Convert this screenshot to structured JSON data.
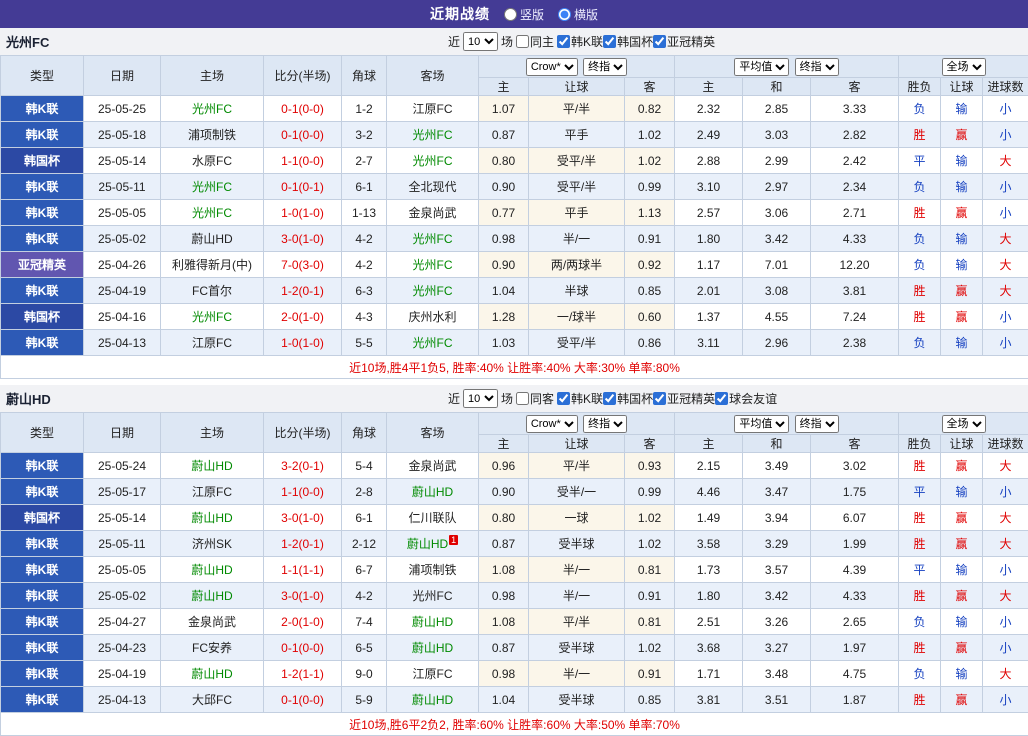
{
  "topbar": {
    "title": "近期战绩",
    "options": [
      {
        "label": "竖版",
        "selected": false
      },
      {
        "label": "横版",
        "selected": true
      }
    ]
  },
  "sections": [
    {
      "team": "光州FC",
      "filter": {
        "near": "近",
        "count": "10",
        "unit": "场",
        "same": "同主",
        "leagues": [
          "韩K联",
          "韩国杯",
          "亚冠精英"
        ]
      },
      "header": {
        "type": "类型",
        "date": "日期",
        "home": "主场",
        "score": "比分(半场)",
        "corner": "角球",
        "away": "客场",
        "odds_source": "Crow*",
        "odds_close": "终指",
        "avg_source": "平均值",
        "avg_close": "终指",
        "scope": "全场",
        "sub_home": "主",
        "sub_handicap": "让球",
        "sub_away": "客",
        "sub_home2": "主",
        "sub_draw": "和",
        "sub_away2": "客",
        "sub_result": "胜负",
        "sub_result_handicap": "让球",
        "sub_goals": "进球数"
      },
      "rows": [
        {
          "type": "韩K联",
          "date": "25-05-25",
          "home": "光州FC",
          "score": "0-1(0-0)",
          "corner": "1-2",
          "away": "江原FC",
          "crow": [
            "1.07",
            "平/半",
            "0.82"
          ],
          "avg": [
            "2.32",
            "2.85",
            "3.33"
          ],
          "res": [
            "负",
            "输",
            "小"
          ]
        },
        {
          "type": "韩K联",
          "date": "25-05-18",
          "home": "浦项制铁",
          "score": "0-1(0-0)",
          "corner": "3-2",
          "away": "光州FC",
          "crow": [
            "0.87",
            "平手",
            "1.02"
          ],
          "avg": [
            "2.49",
            "3.03",
            "2.82"
          ],
          "res": [
            "胜",
            "赢",
            "小"
          ]
        },
        {
          "type": "韩国杯",
          "date": "25-05-14",
          "home": "水原FC",
          "score": "1-1(0-0)",
          "corner": "2-7",
          "away": "光州FC",
          "crow": [
            "0.80",
            "受平/半",
            "1.02"
          ],
          "avg": [
            "2.88",
            "2.99",
            "2.42"
          ],
          "res": [
            "平",
            "输",
            "大"
          ]
        },
        {
          "type": "韩K联",
          "date": "25-05-11",
          "home": "光州FC",
          "score": "0-1(0-1)",
          "corner": "6-1",
          "away": "全北现代",
          "crow": [
            "0.90",
            "受平/半",
            "0.99"
          ],
          "avg": [
            "3.10",
            "2.97",
            "2.34"
          ],
          "res": [
            "负",
            "输",
            "小"
          ]
        },
        {
          "type": "韩K联",
          "date": "25-05-05",
          "home": "光州FC",
          "score": "1-0(1-0)",
          "corner": "1-13",
          "away": "金泉尚武",
          "crow": [
            "0.77",
            "平手",
            "1.13"
          ],
          "avg": [
            "2.57",
            "3.06",
            "2.71"
          ],
          "res": [
            "胜",
            "赢",
            "小"
          ]
        },
        {
          "type": "韩K联",
          "date": "25-05-02",
          "home": "蔚山HD",
          "score": "3-0(1-0)",
          "corner": "4-2",
          "away": "光州FC",
          "crow": [
            "0.98",
            "半/一",
            "0.91"
          ],
          "avg": [
            "1.80",
            "3.42",
            "4.33"
          ],
          "res": [
            "负",
            "输",
            "大"
          ]
        },
        {
          "type": "亚冠精英",
          "date": "25-04-26",
          "home": "利雅得新月(中)",
          "score": "7-0(3-0)",
          "corner": "4-2",
          "away": "光州FC",
          "crow": [
            "0.90",
            "两/两球半",
            "0.92"
          ],
          "avg": [
            "1.17",
            "7.01",
            "12.20"
          ],
          "res": [
            "负",
            "输",
            "大"
          ]
        },
        {
          "type": "韩K联",
          "date": "25-04-19",
          "home": "FC首尔",
          "score": "1-2(0-1)",
          "corner": "6-3",
          "away": "光州FC",
          "crow": [
            "1.04",
            "半球",
            "0.85"
          ],
          "avg": [
            "2.01",
            "3.08",
            "3.81"
          ],
          "res": [
            "胜",
            "赢",
            "大"
          ]
        },
        {
          "type": "韩国杯",
          "date": "25-04-16",
          "home": "光州FC",
          "score": "2-0(1-0)",
          "corner": "4-3",
          "away": "庆州水利",
          "crow": [
            "1.28",
            "一/球半",
            "0.60"
          ],
          "avg": [
            "1.37",
            "4.55",
            "7.24"
          ],
          "res": [
            "胜",
            "赢",
            "小"
          ]
        },
        {
          "type": "韩K联",
          "date": "25-04-13",
          "home": "江原FC",
          "score": "1-0(1-0)",
          "corner": "5-5",
          "away": "光州FC",
          "crow": [
            "1.03",
            "受平/半",
            "0.86"
          ],
          "avg": [
            "3.11",
            "2.96",
            "2.38"
          ],
          "res": [
            "负",
            "输",
            "小"
          ]
        }
      ],
      "summary": "近10场,胜4平1负5, 胜率:40% 让胜率:40% 大率:30% 单率:80%"
    },
    {
      "team": "蔚山HD",
      "filter": {
        "near": "近",
        "count": "10",
        "unit": "场",
        "same": "同客",
        "leagues": [
          "韩K联",
          "韩国杯",
          "亚冠精英",
          "球会友谊"
        ]
      },
      "header": {
        "type": "类型",
        "date": "日期",
        "home": "主场",
        "score": "比分(半场)",
        "corner": "角球",
        "away": "客场",
        "odds_source": "Crow*",
        "odds_close": "终指",
        "avg_source": "平均值",
        "avg_close": "终指",
        "scope": "全场",
        "sub_home": "主",
        "sub_handicap": "让球",
        "sub_away": "客",
        "sub_home2": "主",
        "sub_draw": "和",
        "sub_away2": "客",
        "sub_result": "胜负",
        "sub_result_handicap": "让球",
        "sub_goals": "进球数"
      },
      "rows": [
        {
          "type": "韩K联",
          "date": "25-05-24",
          "home": "蔚山HD",
          "score": "3-2(0-1)",
          "corner": "5-4",
          "away": "金泉尚武",
          "crow": [
            "0.96",
            "平/半",
            "0.93"
          ],
          "avg": [
            "2.15",
            "3.49",
            "3.02"
          ],
          "res": [
            "胜",
            "赢",
            "大"
          ]
        },
        {
          "type": "韩K联",
          "date": "25-05-17",
          "home": "江原FC",
          "score": "1-1(0-0)",
          "corner": "2-8",
          "away": "蔚山HD",
          "crow": [
            "0.90",
            "受半/一",
            "0.99"
          ],
          "avg": [
            "4.46",
            "3.47",
            "1.75"
          ],
          "res": [
            "平",
            "输",
            "小"
          ]
        },
        {
          "type": "韩国杯",
          "date": "25-05-14",
          "home": "蔚山HD",
          "score": "3-0(1-0)",
          "corner": "6-1",
          "away": "仁川联队",
          "crow": [
            "0.80",
            "一球",
            "1.02"
          ],
          "avg": [
            "1.49",
            "3.94",
            "6.07"
          ],
          "res": [
            "胜",
            "赢",
            "大"
          ]
        },
        {
          "type": "韩K联",
          "date": "25-05-11",
          "home": "济州SK",
          "score": "1-2(0-1)",
          "corner": "2-12",
          "away": "蔚山HD",
          "away_card": "1",
          "crow": [
            "0.87",
            "受半球",
            "1.02"
          ],
          "avg": [
            "3.58",
            "3.29",
            "1.99"
          ],
          "res": [
            "胜",
            "赢",
            "大"
          ]
        },
        {
          "type": "韩K联",
          "date": "25-05-05",
          "home": "蔚山HD",
          "score": "1-1(1-1)",
          "corner": "6-7",
          "away": "浦项制铁",
          "crow": [
            "1.08",
            "半/一",
            "0.81"
          ],
          "avg": [
            "1.73",
            "3.57",
            "4.39"
          ],
          "res": [
            "平",
            "输",
            "小"
          ]
        },
        {
          "type": "韩K联",
          "date": "25-05-02",
          "home": "蔚山HD",
          "score": "3-0(1-0)",
          "corner": "4-2",
          "away": "光州FC",
          "crow": [
            "0.98",
            "半/一",
            "0.91"
          ],
          "avg": [
            "1.80",
            "3.42",
            "4.33"
          ],
          "res": [
            "胜",
            "赢",
            "大"
          ]
        },
        {
          "type": "韩K联",
          "date": "25-04-27",
          "home": "金泉尚武",
          "score": "2-0(1-0)",
          "corner": "7-4",
          "away": "蔚山HD",
          "crow": [
            "1.08",
            "平/半",
            "0.81"
          ],
          "avg": [
            "2.51",
            "3.26",
            "2.65"
          ],
          "res": [
            "负",
            "输",
            "小"
          ]
        },
        {
          "type": "韩K联",
          "date": "25-04-23",
          "home": "FC安养",
          "score": "0-1(0-0)",
          "corner": "6-5",
          "away": "蔚山HD",
          "crow": [
            "0.87",
            "受半球",
            "1.02"
          ],
          "avg": [
            "3.68",
            "3.27",
            "1.97"
          ],
          "res": [
            "胜",
            "赢",
            "小"
          ]
        },
        {
          "type": "韩K联",
          "date": "25-04-19",
          "home": "蔚山HD",
          "score": "1-2(1-1)",
          "corner": "9-0",
          "away": "江原FC",
          "crow": [
            "0.98",
            "半/一",
            "0.91"
          ],
          "avg": [
            "1.71",
            "3.48",
            "4.75"
          ],
          "res": [
            "负",
            "输",
            "大"
          ]
        },
        {
          "type": "韩K联",
          "date": "25-04-13",
          "home": "大邱FC",
          "score": "0-1(0-0)",
          "corner": "5-9",
          "away": "蔚山HD",
          "crow": [
            "1.04",
            "受半球",
            "0.85"
          ],
          "avg": [
            "3.81",
            "3.51",
            "1.87"
          ],
          "res": [
            "胜",
            "赢",
            "小"
          ]
        }
      ],
      "summary": "近10场,胜6平2负2, 胜率:60% 让胜率:60% 大率:50% 单率:70%"
    }
  ]
}
